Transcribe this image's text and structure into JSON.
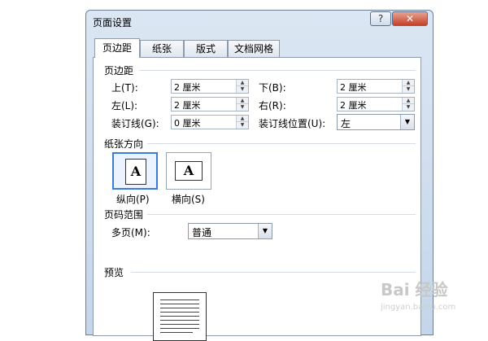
{
  "dialog": {
    "title": "页面设置",
    "help": "?",
    "close": "✕"
  },
  "tabs": [
    "页边距",
    "纸张",
    "版式",
    "文档网格"
  ],
  "margins": {
    "section": "页边距",
    "top_label": "上(T):",
    "top_value": "2 厘米",
    "bottom_label": "下(B):",
    "bottom_value": "2 厘米",
    "left_label": "左(L):",
    "left_value": "2 厘米",
    "right_label": "右(R):",
    "right_value": "2 厘米",
    "gutter_label": "装订线(G):",
    "gutter_value": "0 厘米",
    "gutter_pos_label": "装订线位置(U):",
    "gutter_pos_value": "左"
  },
  "orientation": {
    "section": "纸张方向",
    "portrait": "纵向(P)",
    "landscape": "横向(S)",
    "icon_letter": "A"
  },
  "pages": {
    "section": "页码范围",
    "multi_label": "多页(M):",
    "multi_value": "普通"
  },
  "preview": {
    "section": "预览"
  },
  "watermark": {
    "main": "Bai 经验",
    "sub": "jingyan.baidu.com"
  }
}
